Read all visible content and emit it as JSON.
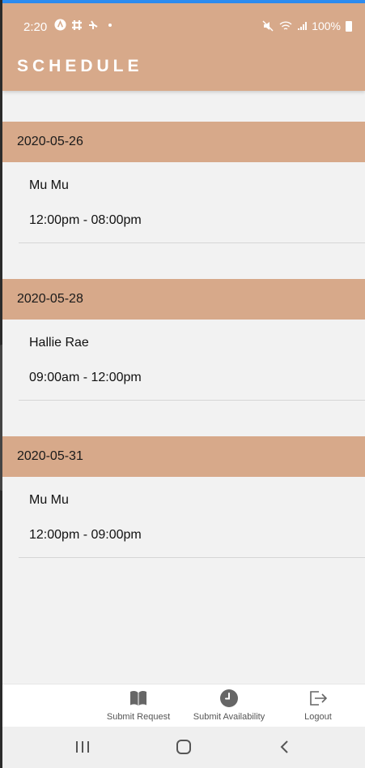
{
  "status_bar": {
    "time": "2:20",
    "battery": "100%",
    "left_icons": [
      "android-icon",
      "slack-icon",
      "pinwheel-icon",
      "dot-icon"
    ],
    "right_icons": [
      "mute-icon",
      "wifi-icon",
      "signal-icon",
      "battery-icon"
    ]
  },
  "header": {
    "title": "SCHEDULE"
  },
  "schedule": [
    {
      "date": "2020-05-26",
      "name": "Mu Mu",
      "time": "12:00pm - 08:00pm"
    },
    {
      "date": "2020-05-28",
      "name": "Hallie Rae",
      "time": "09:00am - 12:00pm"
    },
    {
      "date": "2020-05-31",
      "name": "Mu Mu",
      "time": "12:00pm - 09:00pm"
    }
  ],
  "tabbar": {
    "submit_request": "Submit Request",
    "submit_availability": "Submit Availability",
    "logout": "Logout"
  },
  "colors": {
    "accent": "#d7a98a",
    "background": "#f2f2f2"
  }
}
